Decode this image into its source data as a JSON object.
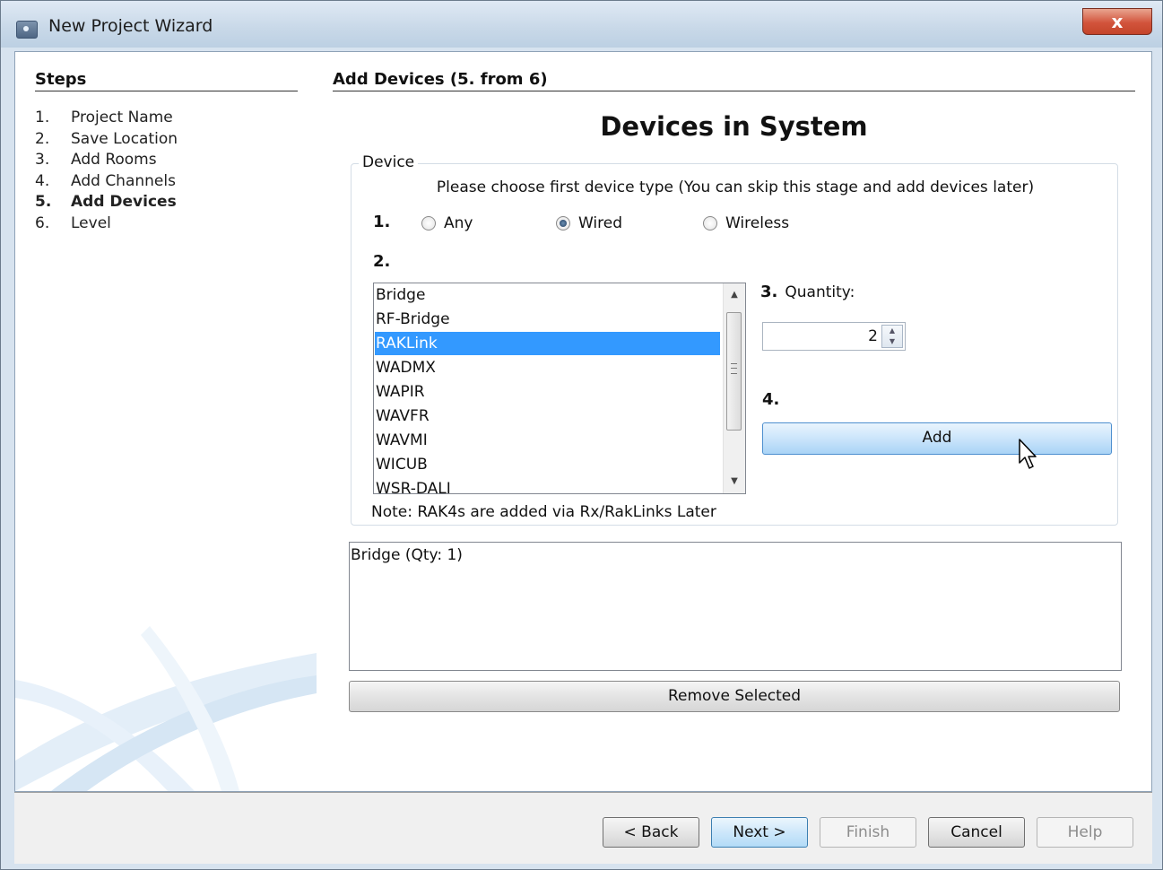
{
  "window": {
    "title": "New Project Wizard",
    "close_glyph": "x"
  },
  "steps": {
    "title": "Steps",
    "items": [
      {
        "num": "1.",
        "label": "Project Name",
        "active": false
      },
      {
        "num": "2.",
        "label": "Save Location",
        "active": false
      },
      {
        "num": "3.",
        "label": "Add Rooms",
        "active": false
      },
      {
        "num": "4.",
        "label": "Add Channels",
        "active": false
      },
      {
        "num": "5.",
        "label": "Add Devices",
        "active": true
      },
      {
        "num": "6.",
        "label": "Level",
        "active": false
      }
    ]
  },
  "main": {
    "heading": "Add Devices (5. from 6)",
    "title": "Devices in System",
    "group_label": "Device",
    "instruction": "Please choose first device type (You can skip this stage and add devices later)",
    "step1_label": "1.",
    "step2_label": "2.",
    "step3_label": "3.",
    "step4_label": "4.",
    "radio_options": [
      {
        "label": "Any",
        "checked": false
      },
      {
        "label": "Wired",
        "checked": true
      },
      {
        "label": "Wireless",
        "checked": false
      }
    ],
    "device_types": [
      "Bridge",
      "RF-Bridge",
      "RAKLink",
      "WADMX",
      "WAPIR",
      "WAVFR",
      "WAVMI",
      "WICUB",
      "WSR-DALI"
    ],
    "selected_device": "RAKLink",
    "quantity_label": "Quantity:",
    "quantity_value": "2",
    "add_button": "Add",
    "note": "Note: RAK4s are added via Rx/RakLinks Later",
    "added_devices": [
      "Bridge (Qty: 1)"
    ],
    "remove_button": "Remove Selected"
  },
  "footer": {
    "back": "< Back",
    "next": "Next >",
    "finish": "Finish",
    "cancel": "Cancel",
    "help": "Help"
  },
  "colors": {
    "selection": "#3399ff",
    "titlebar": "#c8d8e8",
    "close_button": "#d2543c",
    "swoosh": "#dbe9f6"
  }
}
